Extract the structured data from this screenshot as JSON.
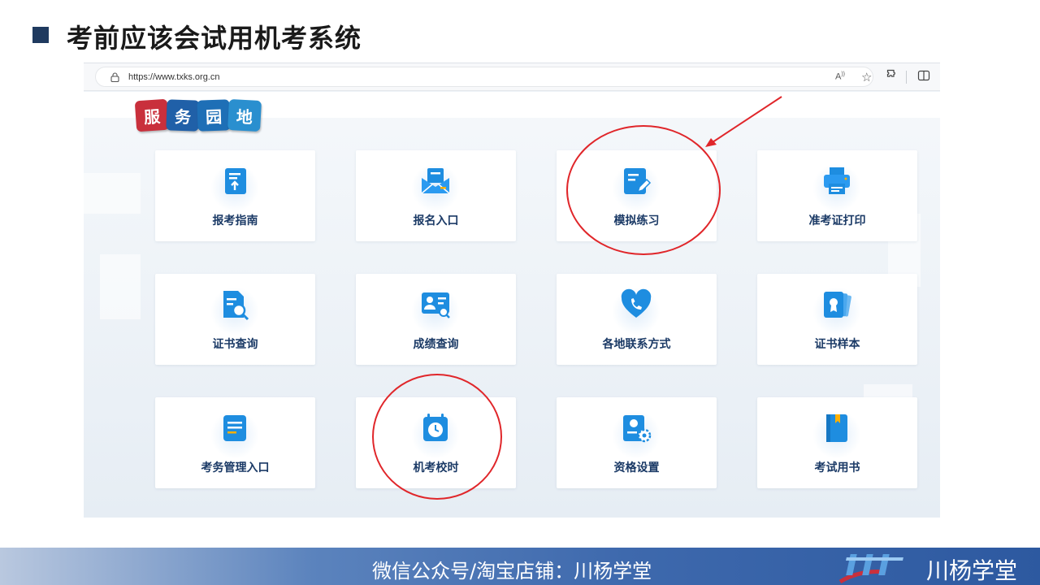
{
  "slide": {
    "title": "考前应该会试用机考系统"
  },
  "browser": {
    "url": "https://www.txks.org.cn",
    "read_aloud_label": "A",
    "accent": "#1b3a66"
  },
  "page": {
    "logo_chars": [
      "服",
      "务",
      "园",
      "地"
    ],
    "cards": [
      {
        "label": "报考指南",
        "icon": "guide-icon"
      },
      {
        "label": "报名入口",
        "icon": "enroll-icon"
      },
      {
        "label": "模拟练习",
        "icon": "practice-icon"
      },
      {
        "label": "准考证打印",
        "icon": "printer-icon"
      },
      {
        "label": "证书查询",
        "icon": "certificate-search-icon"
      },
      {
        "label": "成绩查询",
        "icon": "score-search-icon"
      },
      {
        "label": "各地联系方式",
        "icon": "contact-heart-icon"
      },
      {
        "label": "证书样本",
        "icon": "certificate-sample-icon"
      },
      {
        "label": "考务管理入口",
        "icon": "management-icon"
      },
      {
        "label": "机考校时",
        "icon": "clock-icon"
      },
      {
        "label": "资格设置",
        "icon": "qualification-settings-icon"
      },
      {
        "label": "考试用书",
        "icon": "book-icon"
      }
    ]
  },
  "footer": {
    "text": "微信公众号/淘宝店铺：川杨学堂",
    "brand": "川杨学堂"
  },
  "colors": {
    "annotation_red": "#e0262a",
    "icon_blue": "#1e8de0"
  }
}
